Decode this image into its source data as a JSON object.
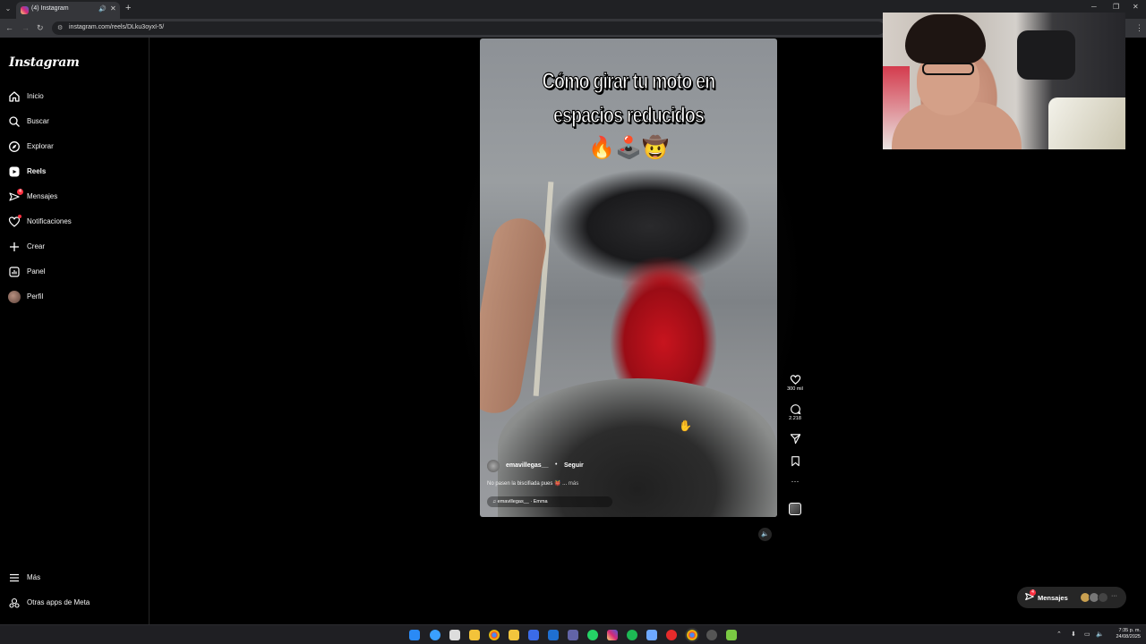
{
  "browser": {
    "tab_title": "(4) Instagram",
    "url": "instagram.com/reels/DLku3oyxI-5/"
  },
  "sidebar": {
    "logo": "Instagram",
    "items": [
      {
        "label": "Inicio",
        "icon": "home-icon"
      },
      {
        "label": "Buscar",
        "icon": "search-icon"
      },
      {
        "label": "Explorar",
        "icon": "compass-icon"
      },
      {
        "label": "Reels",
        "icon": "reels-icon"
      },
      {
        "label": "Mensajes",
        "icon": "messenger-icon",
        "badge": "4"
      },
      {
        "label": "Notificaciones",
        "icon": "heart-icon"
      },
      {
        "label": "Crear",
        "icon": "plus-icon"
      },
      {
        "label": "Panel",
        "icon": "dashboard-icon"
      },
      {
        "label": "Perfil",
        "icon": "avatar-icon"
      }
    ],
    "bottom": [
      {
        "label": "Más",
        "icon": "menu-icon"
      },
      {
        "label": "Otras apps de Meta",
        "icon": "meta-apps-icon"
      }
    ]
  },
  "reel": {
    "title_line1": "Cómo girar tu moto en",
    "title_line2": "espacios reducidos",
    "emojis": "🔥🕹️🤠",
    "username": "emavillegas__",
    "dot": "•",
    "follow": "Seguir",
    "caption": "No pasen la biscifiada pues 👹 ...",
    "caption_more": "más",
    "audio": "♫ emavillegas__ · Emma"
  },
  "actions": {
    "likes": "300 mil",
    "comments": "2.218"
  },
  "messages_pill": {
    "label": "Mensajes",
    "badge": "4"
  },
  "taskbar": {
    "time": "7:35 p. m.",
    "date": "24/08/2025"
  },
  "colors": {
    "background": "#000000",
    "badge": "#ff3040",
    "pill": "#262626"
  }
}
